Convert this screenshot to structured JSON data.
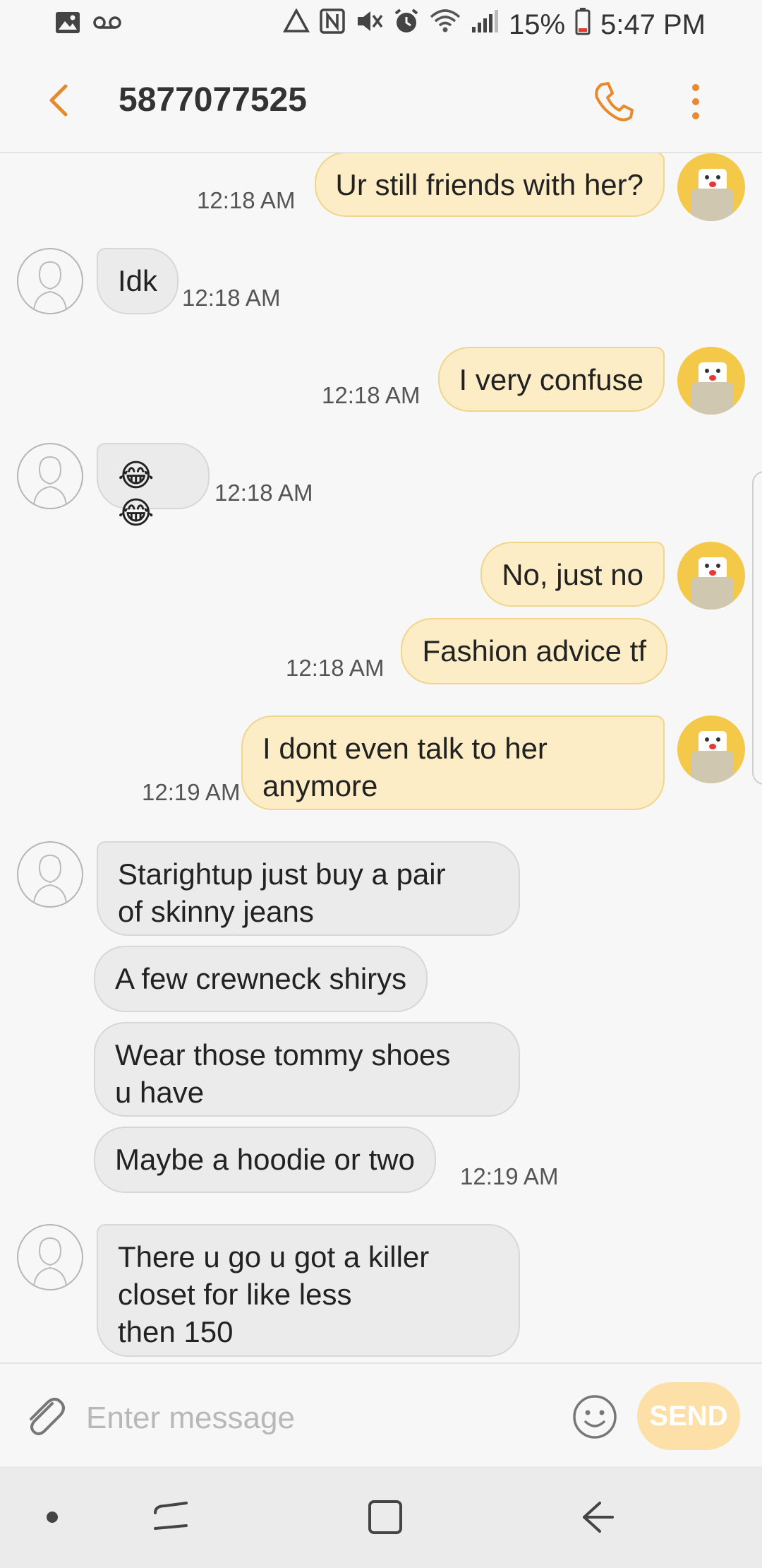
{
  "status_bar": {
    "battery": "15%",
    "time": "5:47 PM",
    "icons": [
      "gallery-icon",
      "voicemail-icon",
      "recycle-icon",
      "nfc-icon",
      "mute-icon",
      "alarm-icon",
      "wifi-icon",
      "signal-icon",
      "battery-icon"
    ]
  },
  "header": {
    "title": "5877077525",
    "accent": "#e8892b"
  },
  "messages": [
    {
      "side": "out",
      "text": "Ur still friends with her?",
      "time": "12:18 AM"
    },
    {
      "side": "in",
      "text": "Idk",
      "time": "12:18 AM"
    },
    {
      "side": "out",
      "text": "I very confuse",
      "time": "12:18 AM"
    },
    {
      "side": "in",
      "text": "😂😂",
      "time": "12:18 AM"
    },
    {
      "side": "out",
      "text": "No, just no",
      "time": ""
    },
    {
      "side": "out",
      "text": "Fashion advice tf",
      "time": "12:18 AM"
    },
    {
      "side": "out",
      "text": "I dont even talk to her\nanymore",
      "time": "12:19 AM"
    },
    {
      "side": "in",
      "text": "Starightup just buy a pair\nof skinny jeans",
      "time": ""
    },
    {
      "side": "in",
      "text": "A few crewneck shirys",
      "time": ""
    },
    {
      "side": "in",
      "text": "Wear those tommy shoes\nu have",
      "time": ""
    },
    {
      "side": "in",
      "text": "Maybe a hoodie or two",
      "time": "12:19 AM"
    },
    {
      "side": "in",
      "text": "There u go u got a killer\ncloset for like less\nthen 150",
      "time": ""
    }
  ],
  "composer": {
    "placeholder": "Enter message",
    "send_label": "SEND"
  },
  "colors": {
    "outgoing_bubble": "#fdedc6",
    "incoming_bubble": "#ebebeb",
    "send_button": "#fde0a8"
  }
}
